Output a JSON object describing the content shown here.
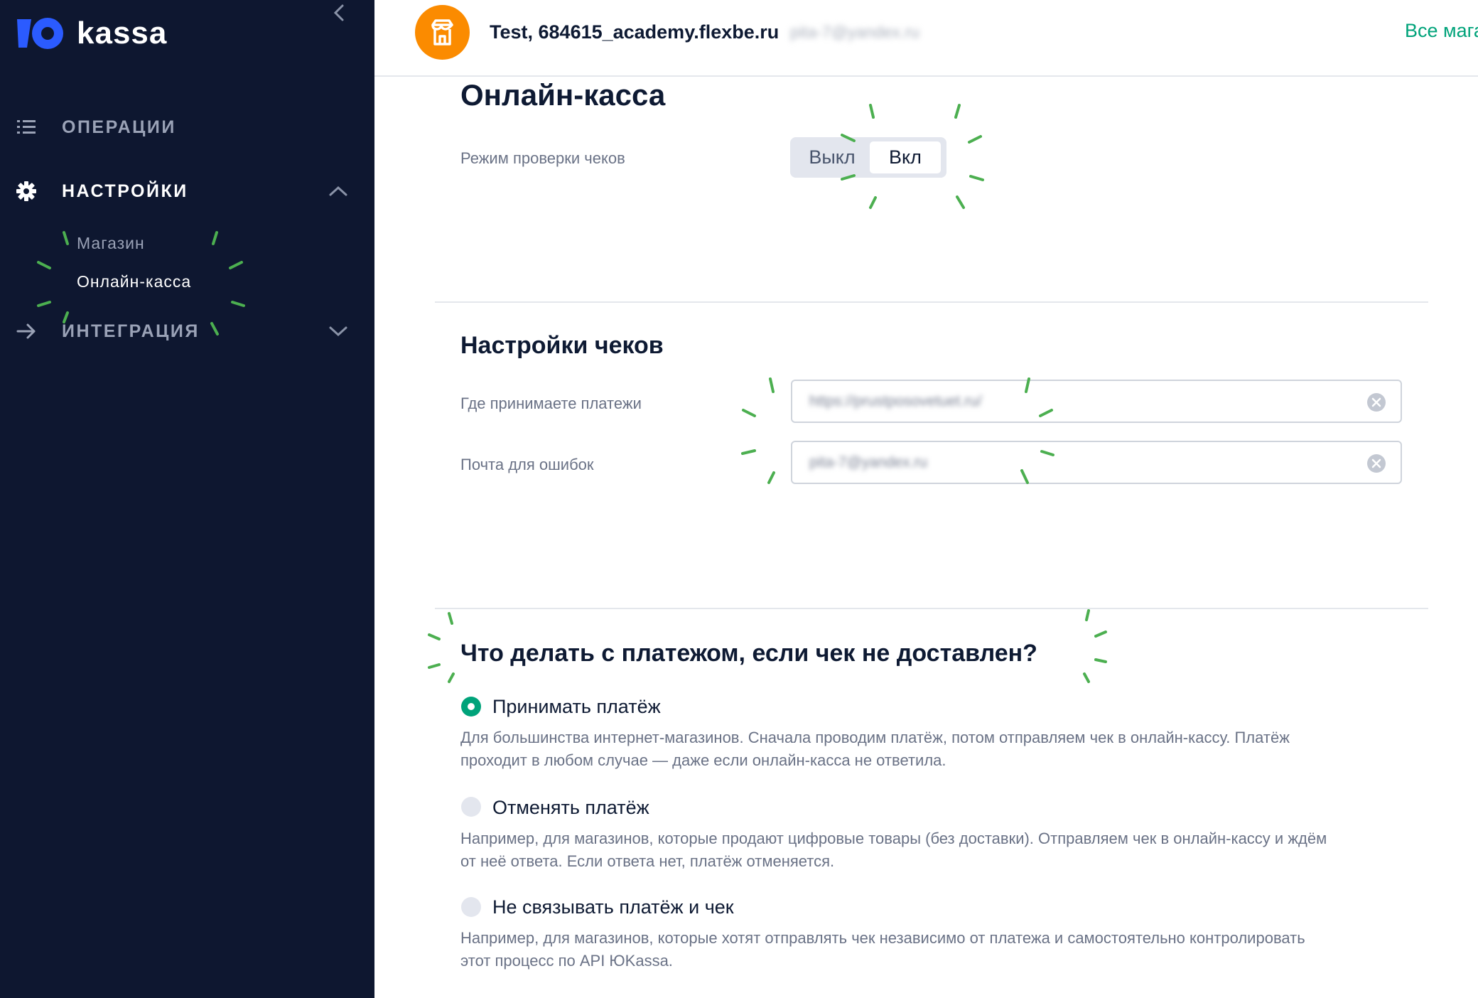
{
  "brand": {
    "logo_text": "kassa",
    "logo_mark": "yu-icon"
  },
  "colors": {
    "sidebar_bg": "#0e1730",
    "accent_green": "#00a37a",
    "shop_avatar": "#fb8b00",
    "sparkle": "#4caf50"
  },
  "sidebar": {
    "collapse_icon": "chevron-left-icon",
    "items": [
      {
        "label": "ОПЕРАЦИИ",
        "icon": "list-icon",
        "expanded": false
      },
      {
        "label": "НАСТРОЙКИ",
        "icon": "gear-icon",
        "expanded": true,
        "children": [
          {
            "label": "Магазин"
          },
          {
            "label": "Онлайн-касса",
            "active": true
          }
        ]
      },
      {
        "label": "ИНТЕГРАЦИЯ",
        "icon": "arrow-right-icon",
        "expanded": false
      }
    ]
  },
  "topbar": {
    "shop_icon": "store-icon",
    "shop_name": "Test, 684615_academy.flexbe.ru",
    "shop_email": "pita-7@yandex.ru",
    "all_shops_link": "Все магазины"
  },
  "online_kassa": {
    "title": "Онлайн-касса",
    "check_mode_label": "Режим проверки чеков",
    "toggle": {
      "off_label": "Выкл",
      "on_label": "Вкл",
      "selected": "Вкл"
    }
  },
  "receipt_settings": {
    "title": "Настройки чеков",
    "fields": [
      {
        "label": "Где принимаете платежи",
        "value": "https://prustposovetuet.ru/"
      },
      {
        "label": "Почта для ошибок",
        "value": "pita-7@yandex.ru"
      }
    ]
  },
  "undelivered": {
    "title": "Что делать с платежом, если чек не доставлен?",
    "options": [
      {
        "label": "Принимать платёж",
        "selected": true,
        "desc_line1": "Для большинства интернет-магазинов. Сначала проводим платёж, потом отправляем чек в онлайн-кассу. Платёж",
        "desc_line2": "проходит в любом случае — даже если онлайн-касса не ответила."
      },
      {
        "label": "Отменять платёж",
        "selected": false,
        "desc_line1": "Например, для магазинов, которые продают цифровые товары (без доставки). Отправляем чек в онлайн-кассу и ждём",
        "desc_line2": "от неё ответа. Если ответа нет, платёж отменяется."
      },
      {
        "label": "Не связывать платёж и чек",
        "selected": false,
        "desc_line1": "Например, для магазинов, которые хотят отправлять чек независимо от платежа и самостоятельно контролировать",
        "desc_line2": "этот процесс по API ЮKassa."
      }
    ]
  }
}
